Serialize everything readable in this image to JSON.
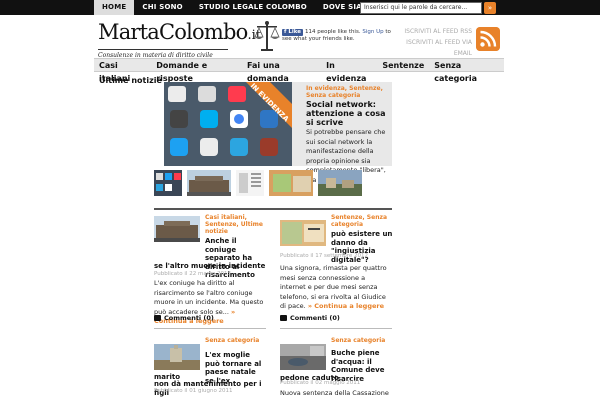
{
  "topnav": {
    "items": [
      "HOME",
      "CHI SONO",
      "STUDIO LEGALE COLOMBO",
      "DOVE SIAMO"
    ],
    "search_placeholder": "Inserisci qui le parole da cercare...",
    "search_button": "»"
  },
  "header": {
    "logo_marta": "Marta",
    "logo_colombo": "Colombo",
    "logo_tld": ".it",
    "tagline": "Consulenze in materia di diritto civile",
    "fb_like": "Like",
    "fb_text_1": "114 people like this.",
    "fb_signup": "Sign Up",
    "fb_text_2": "to see what your friends like.",
    "rss_1": "ISCRIVITI AL FEED RSS",
    "rss_2": "ISCRIVITI AL FEED VIA EMAIL"
  },
  "mainnav": {
    "items": [
      "Casi italiani",
      "Domande e risposte",
      "Fai una domanda",
      "In evidenza",
      "Sentenze",
      "Senza categoria"
    ]
  },
  "content": {
    "section_title": "Ultime notizie",
    "featured": {
      "banner": "IN EVIDENZA",
      "categories": "In evidenza, Sentenze, Senza categoria",
      "title": "Social network: attenzione a cosa si scrive",
      "excerpt": "Si potrebbe pensare che sui social network la manifestazione della propria opinione sia completamente \"libera\", ma così non è...."
    },
    "posts": [
      {
        "categories": "Casi italiani, Sentenze, Ultime notizie",
        "title": "Anche il coniuge separato ha diritto al risarcimento",
        "title_cont": "se l'altro muore in incidente",
        "date": "Pubblicato il 22 marzo 2013",
        "excerpt": "L'ex coniuge ha diritto al risarcimento se l'altro coniuge muore in un incidente. Ma questo può accadere solo se...",
        "read_more": "» Continua a leggere",
        "comments": "Commenti (0)"
      },
      {
        "categories": "Sentenze, Senza categoria",
        "title": "può esistere un danno da \"ingiustizia digitale\"?",
        "date": "Pubblicato il 17 settembre 2012",
        "excerpt": "Una signora, rimasta per quattro mesi senza connessione a internet e per due mesi senza telefono, si era rivolta al Giudice di pace.",
        "read_more": "» Continua a leggere",
        "comments": "Commenti (0)"
      },
      {
        "categories": "Senza categoria",
        "title": "L'ex moglie può tornare al paese natale se l'ex",
        "title_cont_1": "marito",
        "title_cont_2": "non dà mantenimento per i figli",
        "date": "Pubblicato il 01 giugno 2011"
      },
      {
        "categories": "Senza categoria",
        "title": "Buche piene d'acqua: il Comune deve risarcire",
        "title_cont": "pedone caduto",
        "date": "Pubblicato il 02 maggio 2011",
        "excerpt": "Nuova sentenza della Cassazione in"
      }
    ]
  }
}
